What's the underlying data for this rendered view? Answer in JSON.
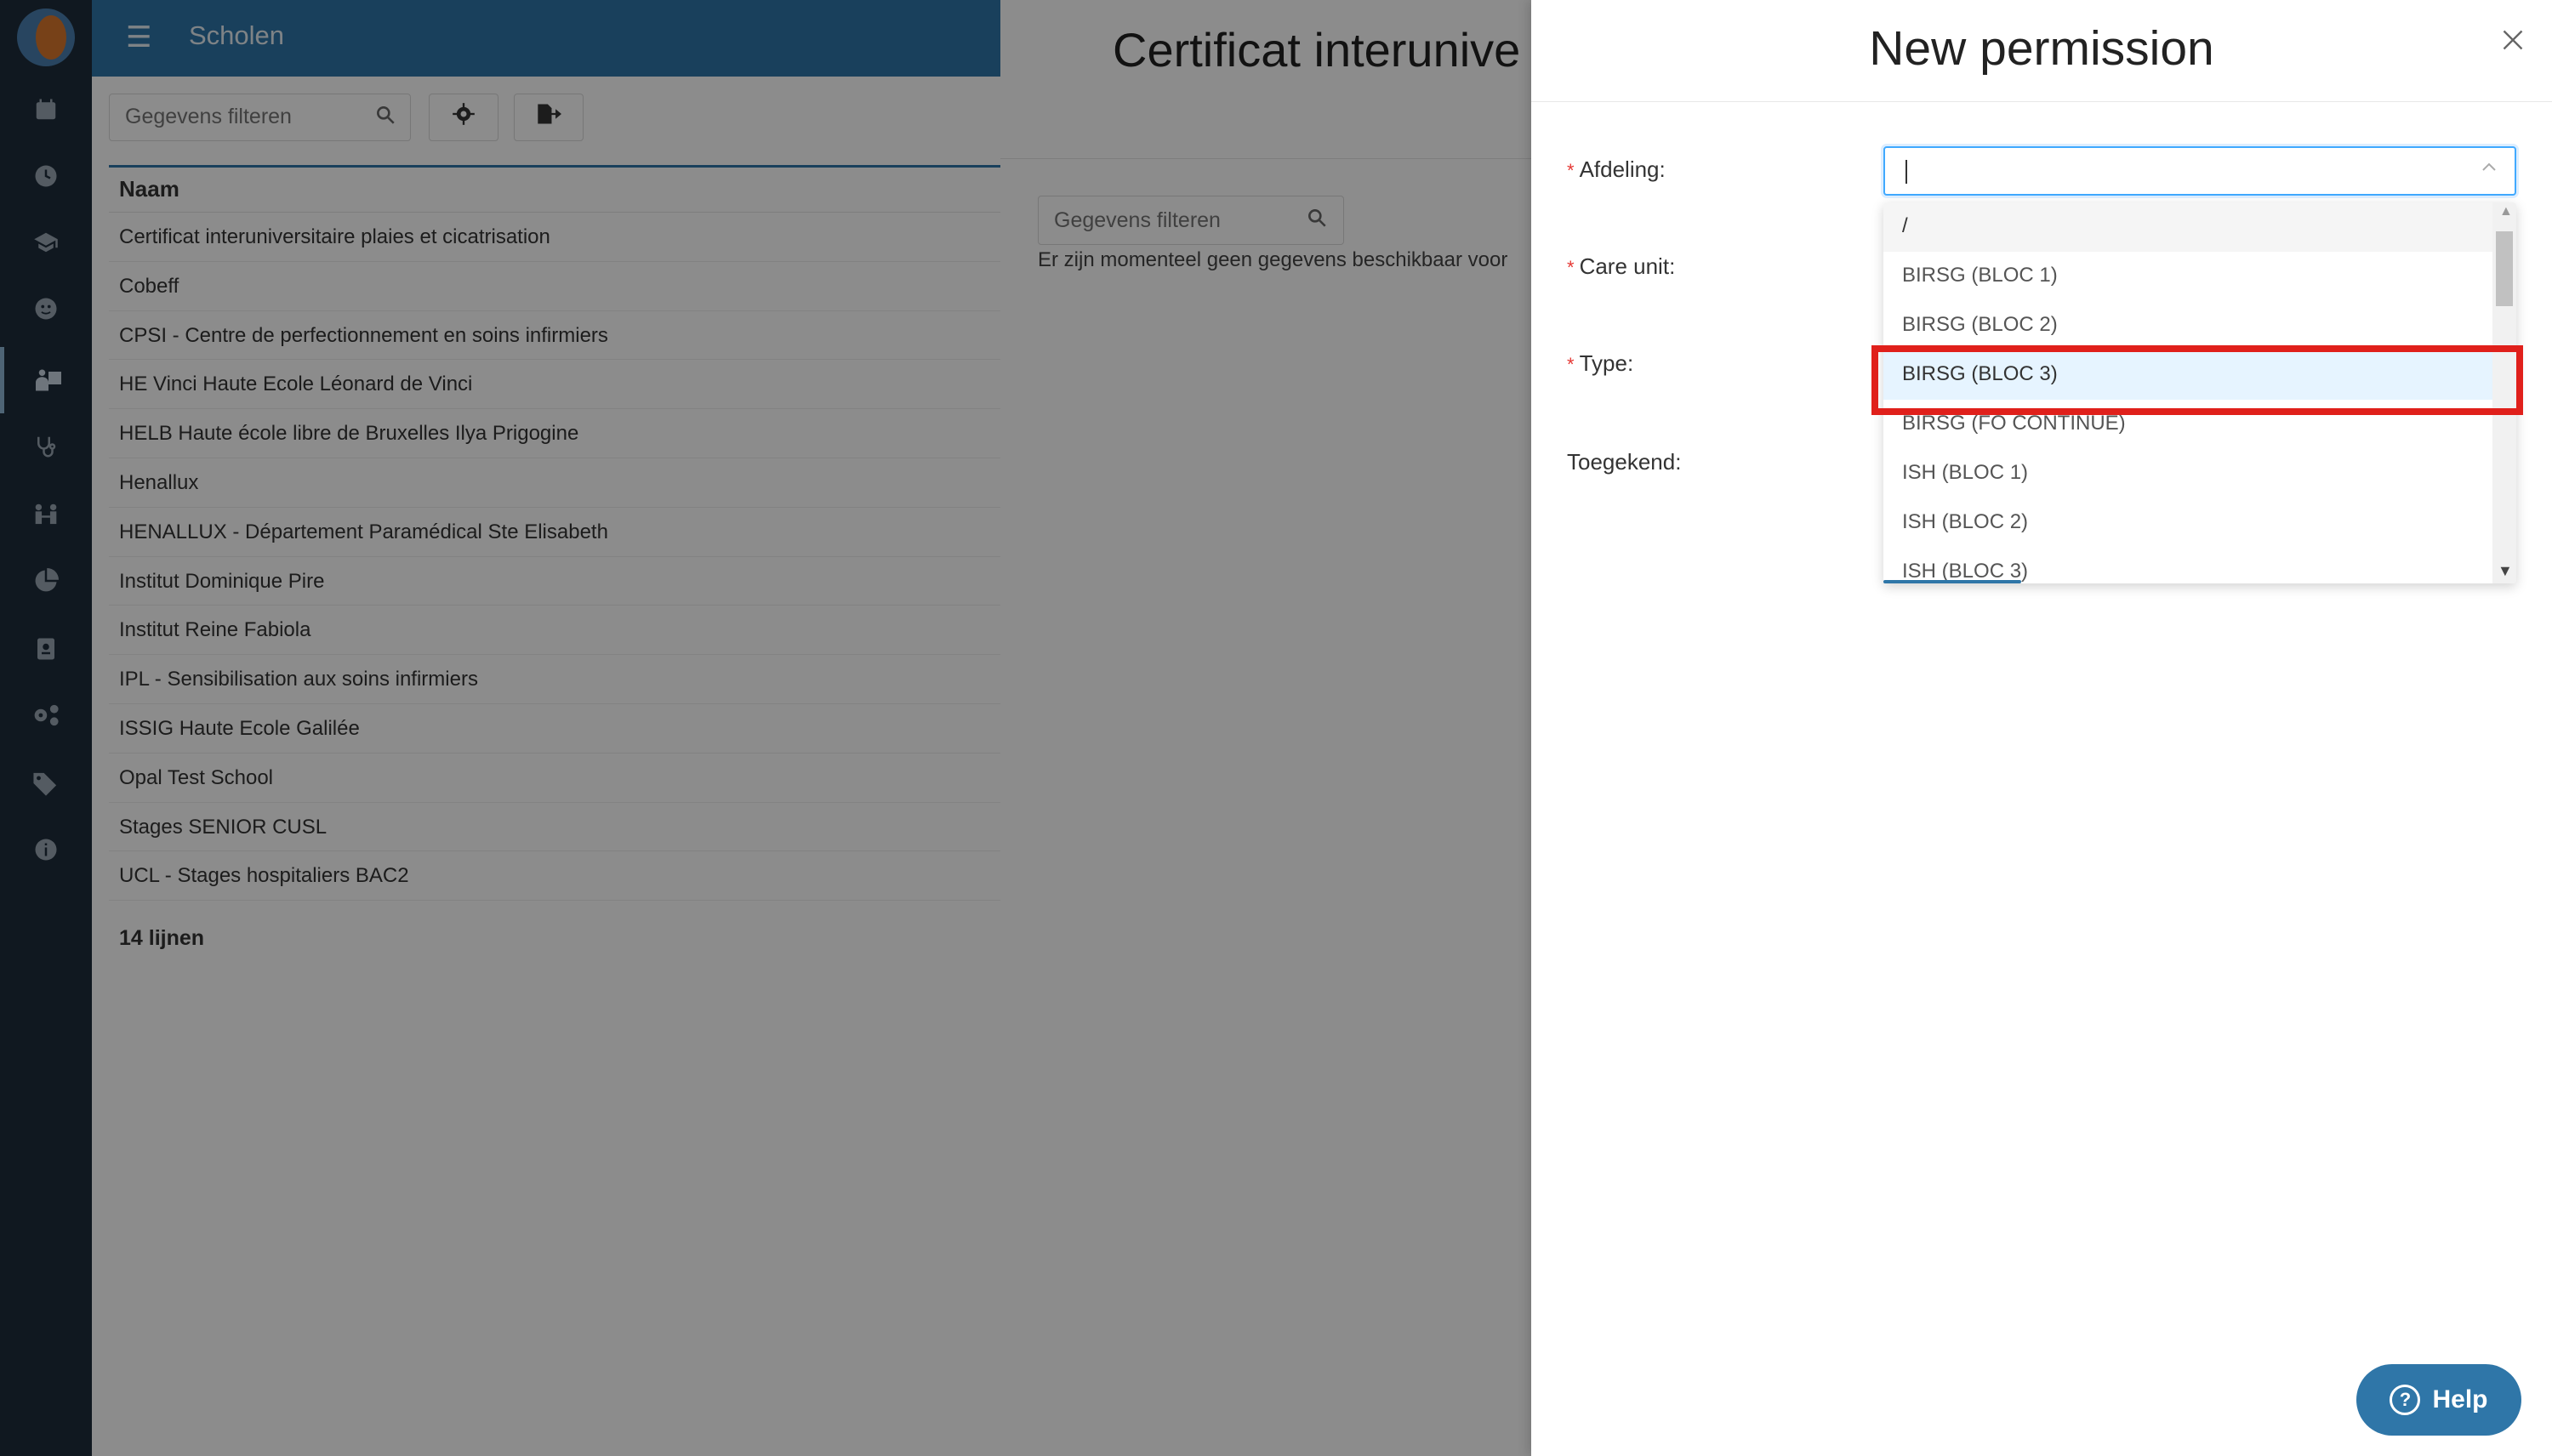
{
  "app": {
    "page_title": "Scholen",
    "menu_icon": "hamburger-icon"
  },
  "rail": {
    "icons": [
      "calendar-icon",
      "clock-icon",
      "student-icon",
      "face-icon",
      "school-icon",
      "stethoscope-icon",
      "people-icon",
      "chart-pie-icon",
      "badge-icon",
      "settings-group-icon",
      "tags-icon",
      "info-icon"
    ]
  },
  "schools": {
    "filter_placeholder": "Gegevens filteren",
    "column_header": "Naam",
    "rows": [
      "Certificat interuniversitaire plaies et cicatrisation",
      "Cobeff",
      "CPSI - Centre de perfectionnement en soins infirmiers",
      "HE Vinci Haute Ecole Léonard de Vinci",
      "HELB Haute école libre de Bruxelles Ilya Prigogine",
      "Henallux",
      "HENALLUX - Département Paramédical Ste Elisabeth",
      "Institut Dominique Pire",
      "Institut Reine Fabiola",
      "IPL - Sensibilisation aux soins infirmiers",
      "ISSIG Haute Ecole Galilée",
      "Opal Test School",
      "Stages SENIOR CUSL",
      "UCL - Stages hospitaliers BAC2"
    ],
    "count_label": "14 lijnen"
  },
  "detail": {
    "title": "Certificat interunive",
    "filter_placeholder": "Gegevens filteren",
    "empty_text": "Er zijn momenteel geen gegevens beschikbaar voor"
  },
  "drawer": {
    "title": "New permission",
    "fields": {
      "afdeling": "Afdeling",
      "care_unit": "Care unit",
      "type": "Type",
      "toegekend": "Toegekend"
    },
    "required_mark": "*",
    "colon": ":",
    "dropdown_options": [
      "/",
      "BIRSG (BLOC 1)",
      "BIRSG (BLOC 2)",
      "BIRSG (BLOC 3)",
      "BIRSG (FO CONTINUE)",
      "ISH (BLOC 1)",
      "ISH (BLOC 2)",
      "ISH (BLOC 3)"
    ],
    "highlighted_option": "BIRSG (BLOC 3)"
  },
  "help": {
    "label": "Help"
  },
  "colors": {
    "primary": "#2f76a8",
    "rail": "#1e2d3b",
    "highlight_border": "#e0201b",
    "required": "#e53935",
    "option_hover": "#e6f4ff"
  }
}
